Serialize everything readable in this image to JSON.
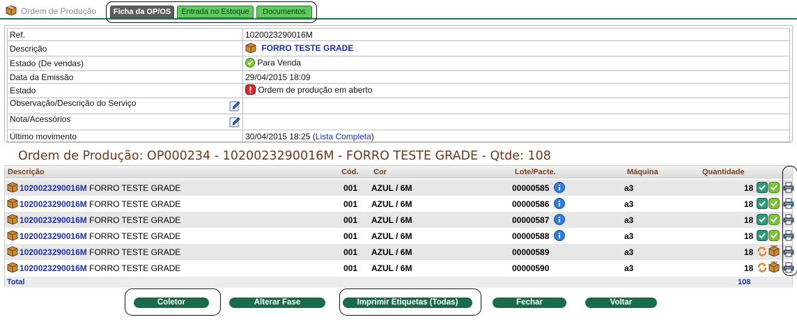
{
  "header": {
    "brand_label": "Ordem de Produção",
    "tabs": [
      {
        "label": "Ficha da OP/OS",
        "active": true
      },
      {
        "label": "Entrada no Estoque",
        "active": false
      },
      {
        "label": "Documentos",
        "active": false
      }
    ]
  },
  "info": {
    "ref_label": "Ref.",
    "ref_value": "1020023290016M",
    "descricao_label": "Descrição",
    "descricao_value": "FORRO TESTE GRADE",
    "estado_vendas_label": "Estado (De vendas)",
    "estado_vendas_value": "Para Venda",
    "data_emissao_label": "Data da Emissão",
    "data_emissao_value": "29/04/2015 18:09",
    "estado_label": "Estado",
    "estado_value": "Ordem de produção em aberto",
    "obs_label": "Observação/Descrição do Serviço",
    "obs_value": "",
    "nota_label": "Nota/Acessórios",
    "nota_value": "",
    "ultimo_mov_label": "Último movimento",
    "ultimo_mov_value": "30/04/2015 18:25 (",
    "ultimo_mov_link": "Lista Completa",
    "ultimo_mov_suffix": ")"
  },
  "production": {
    "title": "Ordem de Produção: OP000234 - 1020023290016M - FORRO TESTE GRADE - Qtde: 108",
    "columns": {
      "descricao": "Descrição",
      "cod": "Cód.",
      "cor": "Cor",
      "lote": "Lote/Pacte.",
      "maquina": "Máquina",
      "quantidade": "Quantidade"
    },
    "rows": [
      {
        "ref": "1020023290016M",
        "desc": "FORRO TESTE GRADE",
        "cod": "001",
        "cor": "AZUL / 6M",
        "lote": "00000585",
        "maquina": "a3",
        "qtd": "18",
        "status": "done"
      },
      {
        "ref": "1020023290016M",
        "desc": "FORRO TESTE GRADE",
        "cod": "001",
        "cor": "AZUL / 6M",
        "lote": "00000586",
        "maquina": "a3",
        "qtd": "18",
        "status": "done"
      },
      {
        "ref": "1020023290016M",
        "desc": "FORRO TESTE GRADE",
        "cod": "001",
        "cor": "AZUL / 6M",
        "lote": "00000587",
        "maquina": "a3",
        "qtd": "18",
        "status": "done"
      },
      {
        "ref": "1020023290016M",
        "desc": "FORRO TESTE GRADE",
        "cod": "001",
        "cor": "AZUL / 6M",
        "lote": "00000588",
        "maquina": "a3",
        "qtd": "18",
        "status": "done"
      },
      {
        "ref": "1020023290016M",
        "desc": "FORRO TESTE GRADE",
        "cod": "001",
        "cor": "AZUL / 6M",
        "lote": "00000589",
        "maquina": "a3",
        "qtd": "18",
        "status": "pending"
      },
      {
        "ref": "1020023290016M",
        "desc": "FORRO TESTE GRADE",
        "cod": "001",
        "cor": "AZUL / 6M",
        "lote": "00000590",
        "maquina": "a3",
        "qtd": "18",
        "status": "pending"
      }
    ],
    "total_label": "Total",
    "total_value": "108"
  },
  "buttons": {
    "coletor": "Coletor",
    "alterar_fase": "Alterar Fase",
    "imprimir_etiquetas": "Imprimir Etiquetas (Todas)",
    "fechar": "Fechar",
    "voltar": "Voltar"
  },
  "colors": {
    "accent_green": "#1a6b4a",
    "tab_green": "#5ec95e",
    "title_brown": "#6b3a1f",
    "link_blue": "#1a2fb4"
  },
  "icons": {
    "box": "box-icon",
    "check": "check-icon",
    "alert": "alert-icon",
    "edit": "edit-icon",
    "info": "info-icon",
    "print": "printer-icon",
    "transfer": "transfer-icon"
  }
}
